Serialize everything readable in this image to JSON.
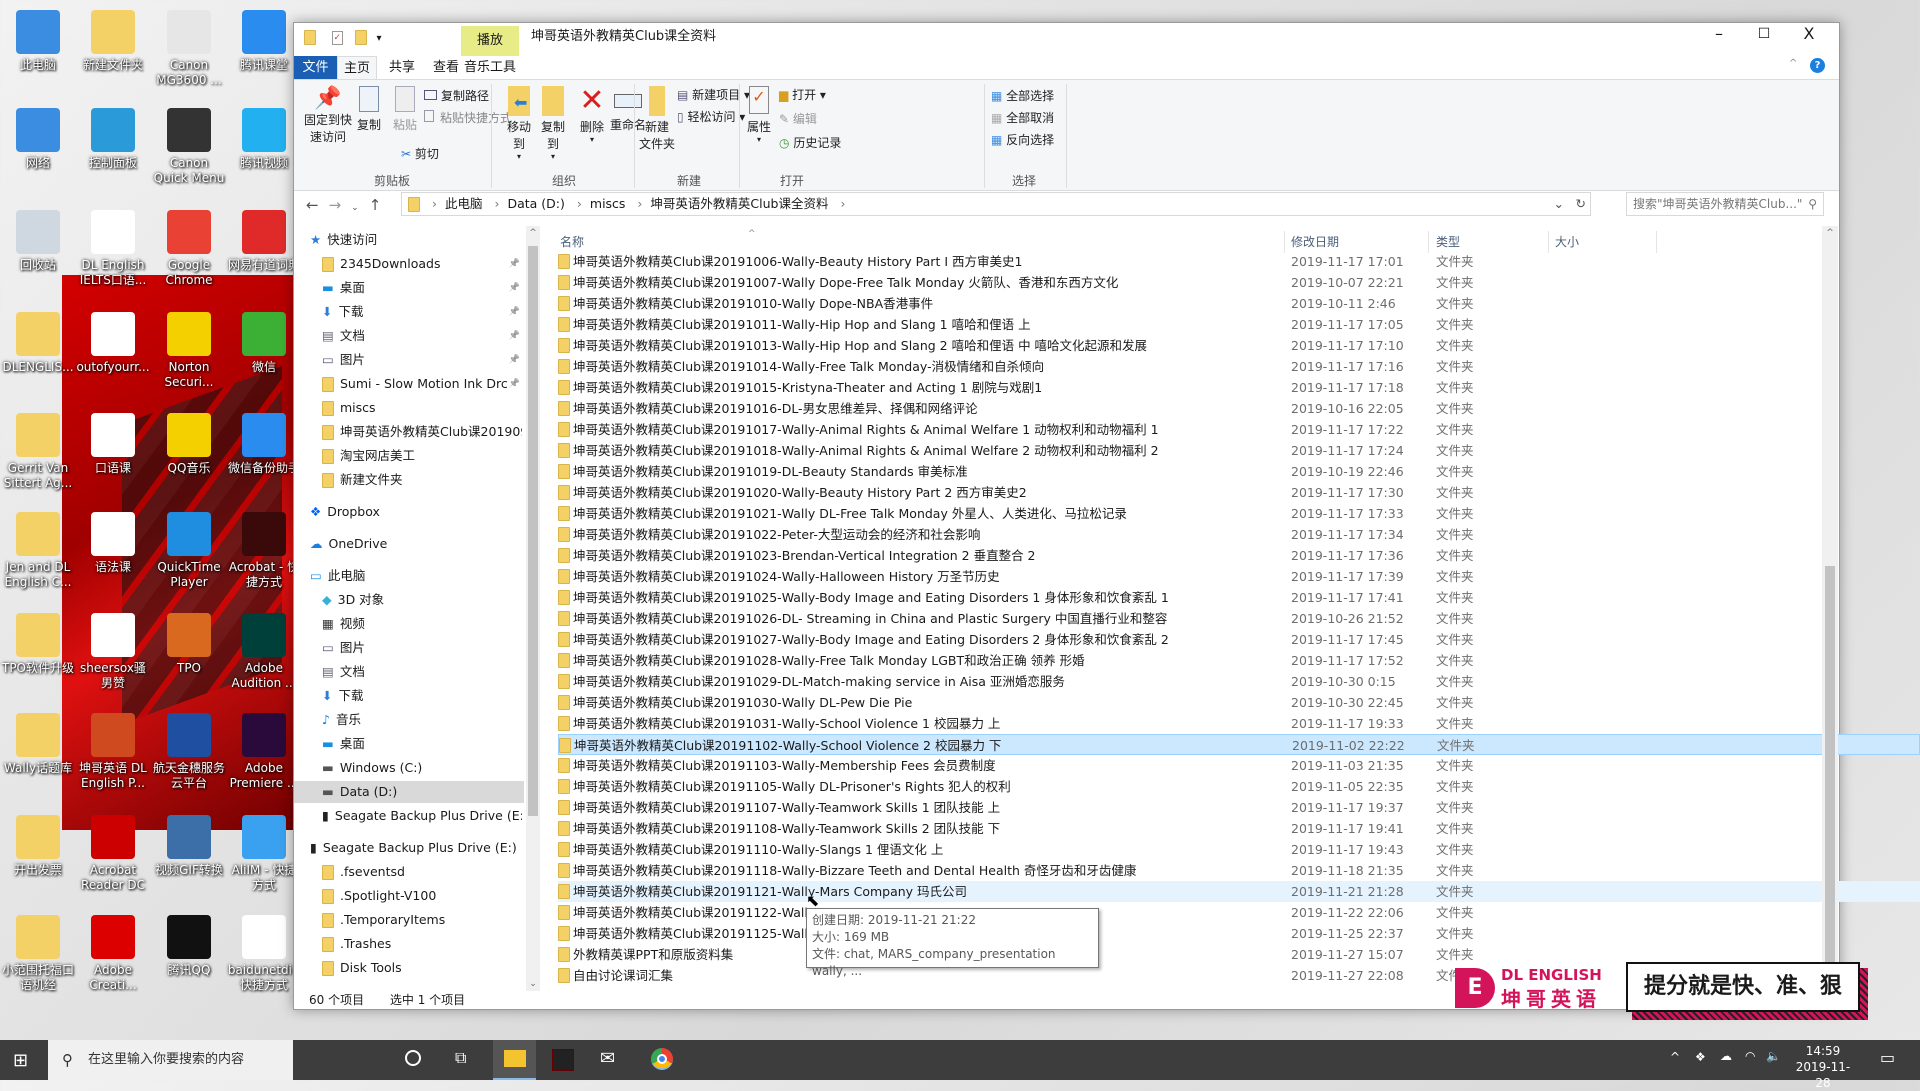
{
  "desktop": {
    "icons": [
      {
        "label": "此电脑",
        "color": "#3a8de0"
      },
      {
        "label": "新建文件夹",
        "color": "#f4d166"
      },
      {
        "label": "Canon MG3600 ...",
        "color": "#e6e6e6"
      },
      {
        "label": "腾讯课堂",
        "color": "#2b8cf0"
      },
      {
        "label": "网络",
        "color": "#3a8de0"
      },
      {
        "label": "控制面板",
        "color": "#2a9ad8"
      },
      {
        "label": "Canon Quick Menu",
        "color": "#333"
      },
      {
        "label": "腾讯视频",
        "color": "#22b0f0"
      },
      {
        "label": "回收站",
        "color": "#cfd8e0"
      },
      {
        "label": "DL English IELTS口语...",
        "color": "#fff"
      },
      {
        "label": "Google Chrome",
        "color": "#e94235"
      },
      {
        "label": "网易有道词典",
        "color": "#e02a2a"
      },
      {
        "label": "DLENGLIS...",
        "color": "#f4d166"
      },
      {
        "label": "outofyourr...",
        "color": "#fff"
      },
      {
        "label": "Norton Securi...",
        "color": "#f5d000"
      },
      {
        "label": "微信",
        "color": "#3cb034"
      },
      {
        "label": "Gerrit Van Sittert Ag...",
        "color": "#f4d166"
      },
      {
        "label": "口语课",
        "color": "#fff"
      },
      {
        "label": "QQ音乐",
        "color": "#f5d000"
      },
      {
        "label": "微信备份助手",
        "color": "#2b8cf0"
      },
      {
        "label": "Jen and DL English C...",
        "color": "#f4d166"
      },
      {
        "label": "语法课",
        "color": "#fff"
      },
      {
        "label": "QuickTime Player",
        "color": "#1f8ee0"
      },
      {
        "label": "Acrobat - 快捷方式",
        "color": "#3a0a0a"
      },
      {
        "label": "TPO软件升级",
        "color": "#f4d166"
      },
      {
        "label": "sheersox骚男赞",
        "color": "#fff"
      },
      {
        "label": "TPO",
        "color": "#d8691e"
      },
      {
        "label": "Adobe Audition ...",
        "color": "#00403a"
      },
      {
        "label": "Wally话题库",
        "color": "#f4d166"
      },
      {
        "label": "坤哥英语 DL English P...",
        "color": "#d04a20"
      },
      {
        "label": "航天金穗服务云平台",
        "color": "#1f4fa0"
      },
      {
        "label": "Adobe Premiere ...",
        "color": "#2a0a3a"
      },
      {
        "label": "开出发票",
        "color": "#f4d166"
      },
      {
        "label": "Acrobat Reader DC",
        "color": "#c00"
      },
      {
        "label": "视频GIF转换",
        "color": "#3c6ea8"
      },
      {
        "label": "AliIM - 快捷方式",
        "color": "#3aa0f0"
      },
      {
        "label": "小范围托福口语机经",
        "color": "#f4d166"
      },
      {
        "label": "Adobe Creati...",
        "color": "#d00"
      },
      {
        "label": "腾讯QQ",
        "color": "#111"
      },
      {
        "label": "baidunetdi - 快捷方式",
        "color": "#fff"
      }
    ]
  },
  "window": {
    "title": "坤哥英语外教精英Club课全资料",
    "context_tab": "播放",
    "tabs": [
      "文件",
      "主页",
      "共享",
      "查看",
      "音乐工具"
    ],
    "controls": {
      "min": "–",
      "max": "☐",
      "close": "X"
    },
    "help": "?"
  },
  "ribbon": {
    "pin": [
      "固定到快",
      "速访问"
    ],
    "copy": "复制",
    "paste": "粘贴",
    "copy_path": "复制路径",
    "paste_shortcut": "粘贴快捷方式",
    "cut": "剪切",
    "clipboard": "剪贴板",
    "move_to": "移动到",
    "copy_to": "复制到",
    "delete": "删除",
    "rename": "重命名",
    "organize": "组织",
    "new_folder": [
      "新建",
      "文件夹"
    ],
    "new_item": "新建项目 ▾",
    "easy_access": "轻松访问 ▾",
    "new": "新建",
    "properties": "属性",
    "open": "打开 ▾",
    "edit": "编辑",
    "history": "历史记录",
    "open_group": "打开",
    "select_all": "全部选择",
    "select_none": "全部取消",
    "invert": "反向选择",
    "select": "选择"
  },
  "address": {
    "crumbs": [
      "此电脑",
      "Data (D:)",
      "miscs",
      "坤哥英语外教精英Club课全资料"
    ],
    "search_placeholder": "搜索\"坤哥英语外教精英Club...\""
  },
  "nav": {
    "items": [
      {
        "label": "快速访问",
        "kind": "star",
        "pinned": false,
        "indent": 0
      },
      {
        "label": "2345Downloads",
        "kind": "folder",
        "pinned": true,
        "indent": 1
      },
      {
        "label": "桌面",
        "kind": "desktop",
        "pinned": true,
        "indent": 1
      },
      {
        "label": "下载",
        "kind": "download",
        "pinned": true,
        "indent": 1
      },
      {
        "label": "文档",
        "kind": "doc",
        "pinned": true,
        "indent": 1
      },
      {
        "label": "图片",
        "kind": "pic",
        "pinned": true,
        "indent": 1
      },
      {
        "label": "Sumi - Slow Motion Ink Drc",
        "kind": "folder",
        "pinned": true,
        "indent": 1
      },
      {
        "label": "miscs",
        "kind": "folder",
        "pinned": false,
        "indent": 1
      },
      {
        "label": "坤哥英语外教精英Club课201909",
        "kind": "folder",
        "pinned": false,
        "indent": 1
      },
      {
        "label": "淘宝网店美工",
        "kind": "folder",
        "pinned": false,
        "indent": 1
      },
      {
        "label": "新建文件夹",
        "kind": "folder",
        "pinned": false,
        "indent": 1
      },
      {
        "label": "Dropbox",
        "kind": "dropbox",
        "pinned": false,
        "indent": 0
      },
      {
        "label": "OneDrive",
        "kind": "cloud",
        "pinned": false,
        "indent": 0
      },
      {
        "label": "此电脑",
        "kind": "pc",
        "pinned": false,
        "indent": 0
      },
      {
        "label": "3D 对象",
        "kind": "cube",
        "pinned": false,
        "indent": 1
      },
      {
        "label": "视频",
        "kind": "video",
        "pinned": false,
        "indent": 1
      },
      {
        "label": "图片",
        "kind": "pic",
        "pinned": false,
        "indent": 1
      },
      {
        "label": "文档",
        "kind": "doc",
        "pinned": false,
        "indent": 1
      },
      {
        "label": "下载",
        "kind": "download",
        "pinned": false,
        "indent": 1
      },
      {
        "label": "音乐",
        "kind": "music",
        "pinned": false,
        "indent": 1
      },
      {
        "label": "桌面",
        "kind": "desktop",
        "pinned": false,
        "indent": 1
      },
      {
        "label": "Windows (C:)",
        "kind": "drive",
        "pinned": false,
        "indent": 1
      },
      {
        "label": "Data (D:)",
        "kind": "drive",
        "pinned": false,
        "indent": 1,
        "selected": true
      },
      {
        "label": "Seagate Backup Plus Drive (E:)",
        "kind": "ext",
        "pinned": false,
        "indent": 1
      },
      {
        "label": "Seagate Backup Plus Drive (E:)",
        "kind": "ext",
        "pinned": false,
        "indent": 0
      },
      {
        "label": ".fseventsd",
        "kind": "folder",
        "pinned": false,
        "indent": 1
      },
      {
        "label": ".Spotlight-V100",
        "kind": "folder",
        "pinned": false,
        "indent": 1
      },
      {
        "label": ".TemporaryItems",
        "kind": "folder",
        "pinned": false,
        "indent": 1
      },
      {
        "label": ".Trashes",
        "kind": "folder",
        "pinned": false,
        "indent": 1
      },
      {
        "label": "Disk Tools",
        "kind": "folder",
        "pinned": false,
        "indent": 1
      }
    ]
  },
  "list": {
    "columns": [
      "名称",
      "修改日期",
      "类型",
      "大小"
    ],
    "rows": [
      {
        "name": "坤哥英语外教精英Club课20191006-Wally-Beauty History Part I 西方审美史1",
        "date": "2019-11-17 17:01",
        "type": "文件夹"
      },
      {
        "name": "坤哥英语外教精英Club课20191007-Wally Dope-Free Talk Monday 火箭队、香港和东西方文化",
        "date": "2019-10-07 22:21",
        "type": "文件夹"
      },
      {
        "name": "坤哥英语外教精英Club课20191010-Wally Dope-NBA香港事件",
        "date": "2019-10-11 2:46",
        "type": "文件夹"
      },
      {
        "name": "坤哥英语外教精英Club课20191011-Wally-Hip Hop and Slang 1 嘻哈和俚语 上",
        "date": "2019-11-17 17:05",
        "type": "文件夹"
      },
      {
        "name": "坤哥英语外教精英Club课20191013-Wally-Hip Hop and Slang 2 嘻哈和俚语 中 嘻哈文化起源和发展",
        "date": "2019-11-17 17:10",
        "type": "文件夹"
      },
      {
        "name": "坤哥英语外教精英Club课20191014-Wally-Free Talk Monday-消极情绪和自杀倾向",
        "date": "2019-11-17 17:16",
        "type": "文件夹"
      },
      {
        "name": "坤哥英语外教精英Club课20191015-Kristyna-Theater and Acting 1 剧院与戏剧1",
        "date": "2019-11-17 17:18",
        "type": "文件夹"
      },
      {
        "name": "坤哥英语外教精英Club课20191016-DL-男女思维差异、择偶和网络评论",
        "date": "2019-10-16 22:05",
        "type": "文件夹"
      },
      {
        "name": "坤哥英语外教精英Club课20191017-Wally-Animal Rights & Animal Welfare 1 动物权利和动物福利 1",
        "date": "2019-11-17 17:22",
        "type": "文件夹"
      },
      {
        "name": "坤哥英语外教精英Club课20191018-Wally-Animal Rights & Animal Welfare 2 动物权利和动物福利 2",
        "date": "2019-11-17 17:24",
        "type": "文件夹"
      },
      {
        "name": "坤哥英语外教精英Club课20191019-DL-Beauty Standards 审美标准",
        "date": "2019-10-19 22:46",
        "type": "文件夹"
      },
      {
        "name": "坤哥英语外教精英Club课20191020-Wally-Beauty History Part 2 西方审美史2",
        "date": "2019-11-17 17:30",
        "type": "文件夹"
      },
      {
        "name": "坤哥英语外教精英Club课20191021-Wally DL-Free Talk Monday 外星人、人类进化、马拉松记录",
        "date": "2019-11-17 17:33",
        "type": "文件夹"
      },
      {
        "name": "坤哥英语外教精英Club课20191022-Peter-大型运动会的经济和社会影响",
        "date": "2019-11-17 17:34",
        "type": "文件夹"
      },
      {
        "name": "坤哥英语外教精英Club课20191023-Brendan-Vertical Integration 2 垂直整合 2",
        "date": "2019-11-17 17:36",
        "type": "文件夹"
      },
      {
        "name": "坤哥英语外教精英Club课20191024-Wally-Halloween History 万圣节历史",
        "date": "2019-11-17 17:39",
        "type": "文件夹"
      },
      {
        "name": "坤哥英语外教精英Club课20191025-Wally-Body Image and Eating Disorders 1 身体形象和饮食紊乱 1",
        "date": "2019-11-17 17:41",
        "type": "文件夹"
      },
      {
        "name": "坤哥英语外教精英Club课20191026-DL- Streaming in China and Plastic Surgery 中国直播行业和整容",
        "date": "2019-10-26 21:52",
        "type": "文件夹"
      },
      {
        "name": "坤哥英语外教精英Club课20191027-Wally-Body Image and Eating Disorders 2 身体形象和饮食紊乱 2",
        "date": "2019-11-17 17:45",
        "type": "文件夹"
      },
      {
        "name": "坤哥英语外教精英Club课20191028-Wally-Free Talk Monday LGBT和政治正确 领养 形婚",
        "date": "2019-11-17 17:52",
        "type": "文件夹"
      },
      {
        "name": "坤哥英语外教精英Club课20191029-DL-Match-making service in Aisa 亚洲婚恋服务",
        "date": "2019-10-30 0:15",
        "type": "文件夹"
      },
      {
        "name": "坤哥英语外教精英Club课20191030-Wally DL-Pew Die Pie",
        "date": "2019-10-30 22:45",
        "type": "文件夹"
      },
      {
        "name": "坤哥英语外教精英Club课20191031-Wally-School Violence 1 校园暴力 上",
        "date": "2019-11-17 19:33",
        "type": "文件夹"
      },
      {
        "name": "坤哥英语外教精英Club课20191102-Wally-School Violence 2 校园暴力 下",
        "date": "2019-11-02 22:22",
        "type": "文件夹",
        "selected": true
      },
      {
        "name": "坤哥英语外教精英Club课20191103-Wally-Membership Fees 会员费制度",
        "date": "2019-11-03 21:35",
        "type": "文件夹"
      },
      {
        "name": "坤哥英语外教精英Club课20191105-Wally DL-Prisoner's Rights 犯人的权利",
        "date": "2019-11-05 22:35",
        "type": "文件夹"
      },
      {
        "name": "坤哥英语外教精英Club课20191107-Wally-Teamwork Skills 1 团队技能 上",
        "date": "2019-11-17 19:37",
        "type": "文件夹"
      },
      {
        "name": "坤哥英语外教精英Club课20191108-Wally-Teamwork Skills 2 团队技能 下",
        "date": "2019-11-17 19:41",
        "type": "文件夹"
      },
      {
        "name": "坤哥英语外教精英Club课20191110-Wally-Slangs 1 俚语文化 上",
        "date": "2019-11-17 19:43",
        "type": "文件夹"
      },
      {
        "name": "坤哥英语外教精英Club课20191118-Wally-Bizzare Teeth and Dental Health 奇怪牙齿和牙齿健康",
        "date": "2019-11-18 21:35",
        "type": "文件夹"
      },
      {
        "name": "坤哥英语外教精英Club课20191121-Wally-Mars Company 玛氏公司",
        "date": "2019-11-21 21:28",
        "type": "文件夹",
        "hover": true
      },
      {
        "name": "坤哥英语外教精英Club课20191122-Wally",
        "date": "2019-11-22 22:06",
        "type": "文件夹"
      },
      {
        "name": "坤哥英语外教精英Club课20191125-Wally",
        "date": "2019-11-25 22:37",
        "type": "文件夹"
      },
      {
        "name": "外教精英课PPT和原版资料集",
        "date": "2019-11-27 15:07",
        "type": "文件夹"
      },
      {
        "name": "自由讨论课词汇集",
        "date": "2019-11-27 22:08",
        "type": "文件夹"
      }
    ]
  },
  "tooltip": {
    "created": "创建日期: 2019-11-21 21:22",
    "size": "大小: 169 MB",
    "files": "文件: chat, MARS_company_presentation wally, ..."
  },
  "status": {
    "count": "60 个项目",
    "selected": "选中 1 个项目"
  },
  "watermark": {
    "brand_en": "DL ENGLISH",
    "brand_cn": "坤哥英语",
    "slogan": "提分就是快、准、狠",
    "accent": "#d4145a"
  },
  "taskbar": {
    "search_placeholder": "在这里输入你要搜索的内容",
    "time": "14:59",
    "date": "2019-11-28"
  }
}
